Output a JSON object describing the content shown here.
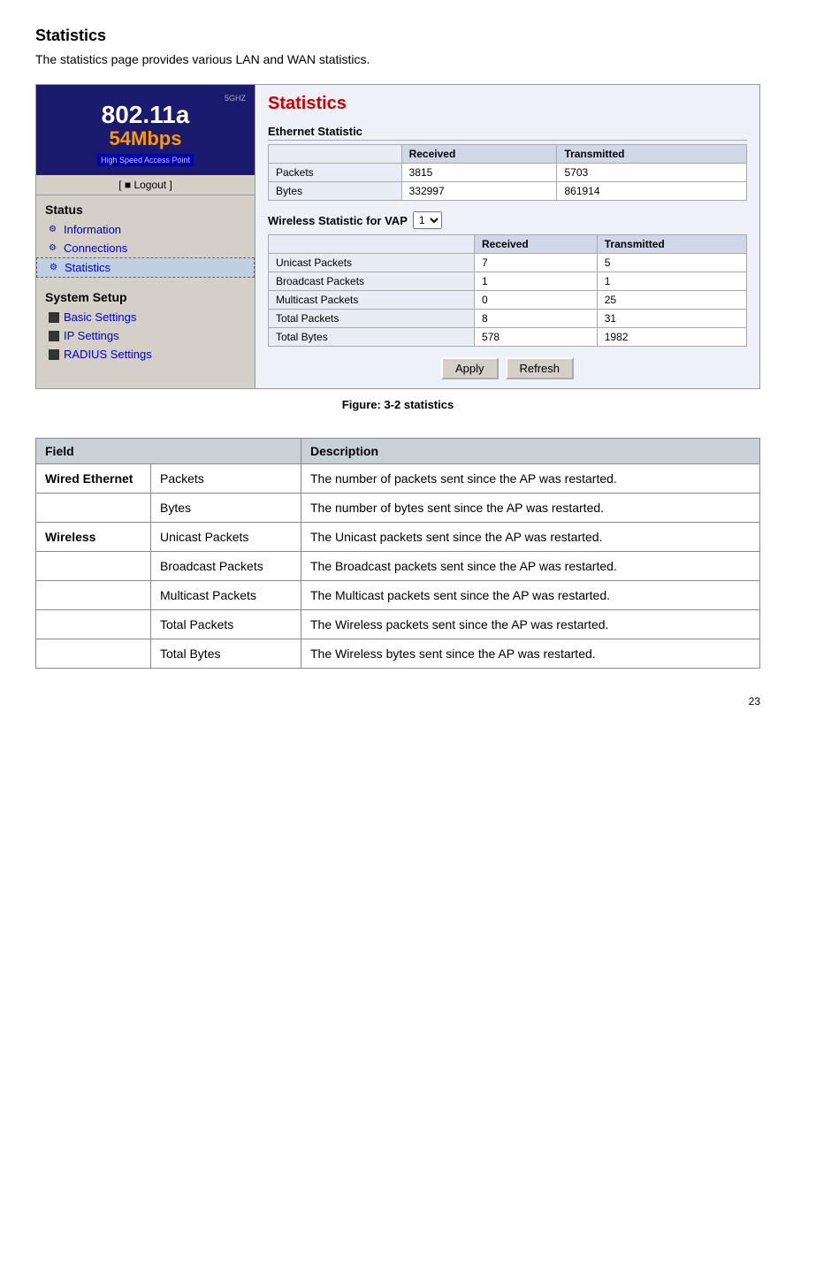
{
  "page": {
    "title": "Statistics",
    "subtitle": "The statistics page provides various LAN and WAN statistics.",
    "figure_caption": "Figure: 3-2 statistics",
    "page_number": "23"
  },
  "sidebar": {
    "logo": {
      "ghz": "5GHZ",
      "model": "802.11a",
      "speed": "54Mbps",
      "tagline": "High Speed Access Point"
    },
    "logout_text": "[ ■ Logout ]",
    "status_label": "Status",
    "items_status": [
      {
        "label": "Information",
        "active": false
      },
      {
        "label": "Connections",
        "active": false
      },
      {
        "label": "Statistics",
        "active": true
      }
    ],
    "system_setup_label": "System Setup",
    "items_system": [
      {
        "label": "Basic Settings",
        "active": false
      },
      {
        "label": "IP Settings",
        "active": false
      },
      {
        "label": "RADIUS Settings",
        "active": false
      }
    ]
  },
  "content": {
    "title": "Statistics",
    "ethernet_section_label": "Ethernet Statistic",
    "ethernet_headers": [
      "",
      "Received",
      "Transmitted"
    ],
    "ethernet_rows": [
      {
        "label": "Packets",
        "received": "3815",
        "transmitted": "5703"
      },
      {
        "label": "Bytes",
        "received": "332997",
        "transmitted": "861914"
      }
    ],
    "vap_label": "Wireless Statistic for VAP",
    "vap_value": "1",
    "wireless_headers": [
      "",
      "Received",
      "Transmitted"
    ],
    "wireless_rows": [
      {
        "label": "Unicast Packets",
        "received": "7",
        "transmitted": "5"
      },
      {
        "label": "Broadcast Packets",
        "received": "1",
        "transmitted": "1"
      },
      {
        "label": "Multicast Packets",
        "received": "0",
        "transmitted": "25"
      },
      {
        "label": "Total Packets",
        "received": "8",
        "transmitted": "31"
      },
      {
        "label": "Total Bytes",
        "received": "578",
        "transmitted": "1982"
      }
    ],
    "apply_label": "Apply",
    "refresh_label": "Refresh"
  },
  "description_table": {
    "col_field": "Field",
    "col_description": "Description",
    "rows": [
      {
        "field": "Wired Ethernet",
        "subfield": "Packets",
        "description": "The number of packets sent since the AP was restarted."
      },
      {
        "field": "",
        "subfield": "Bytes",
        "description": "The number of bytes sent since the AP was restarted."
      },
      {
        "field": "Wireless",
        "subfield": "Unicast Packets",
        "description": "The Unicast packets sent since the AP was restarted."
      },
      {
        "field": "",
        "subfield": "Broadcast Packets",
        "description": "The Broadcast packets sent since the AP was restarted."
      },
      {
        "field": "",
        "subfield": "Multicast Packets",
        "description": "The Multicast packets sent since the AP was restarted."
      },
      {
        "field": "",
        "subfield": "Total Packets",
        "description": "The Wireless packets sent since the AP was restarted."
      },
      {
        "field": "",
        "subfield": "Total Bytes",
        "description": "The Wireless bytes sent since the AP was restarted."
      }
    ]
  }
}
